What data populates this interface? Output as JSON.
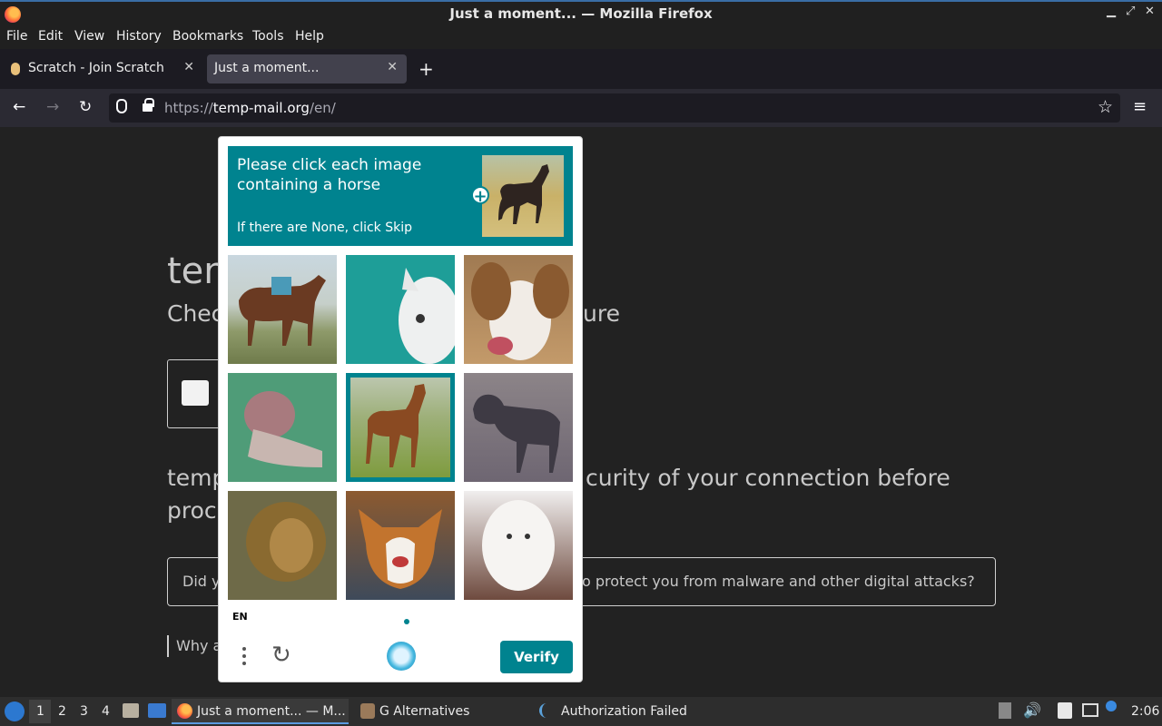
{
  "window": {
    "title": "Just a moment... — Mozilla Firefox"
  },
  "menubar": {
    "items": [
      "File",
      "Edit",
      "View",
      "History",
      "Bookmarks",
      "Tools",
      "Help"
    ]
  },
  "tabs": [
    {
      "label": "Scratch - Join Scratch",
      "active": false
    },
    {
      "label": "Just a moment...",
      "active": true
    }
  ],
  "nav": {
    "url_scheme": "https://",
    "url_host": "temp-mail.org",
    "url_path": "/en/"
  },
  "page": {
    "heading_fragment": "ten",
    "sub_left": "Chec",
    "sub_right": "ure",
    "body_right1": "curity of your connection before",
    "body_left1": "temp",
    "body_left2": "proc",
    "box_left": "Did y",
    "box_right": "o protect you from malware and other digital attacks?",
    "why_fragment": "Why a"
  },
  "captcha": {
    "prompt": "Please click each image containing a horse",
    "subtext": "If there are None, click Skip",
    "language": "EN",
    "verify_label": "Verify",
    "tiles": [
      {
        "subject": "horse",
        "selected": false
      },
      {
        "subject": "cat",
        "selected": false
      },
      {
        "subject": "dog",
        "selected": false
      },
      {
        "subject": "lion",
        "selected": false
      },
      {
        "subject": "horse",
        "selected": true
      },
      {
        "subject": "horse",
        "selected": false
      },
      {
        "subject": "lion",
        "selected": false
      },
      {
        "subject": "dog",
        "selected": false
      },
      {
        "subject": "dog",
        "selected": false
      }
    ],
    "accent_color": "#00838f"
  },
  "taskbar": {
    "workspaces": [
      "1",
      "2",
      "3",
      "4"
    ],
    "tasks": [
      "Just a moment... — M...",
      "G Alternatives",
      "Authorization Failed"
    ],
    "clock": "2:06"
  }
}
